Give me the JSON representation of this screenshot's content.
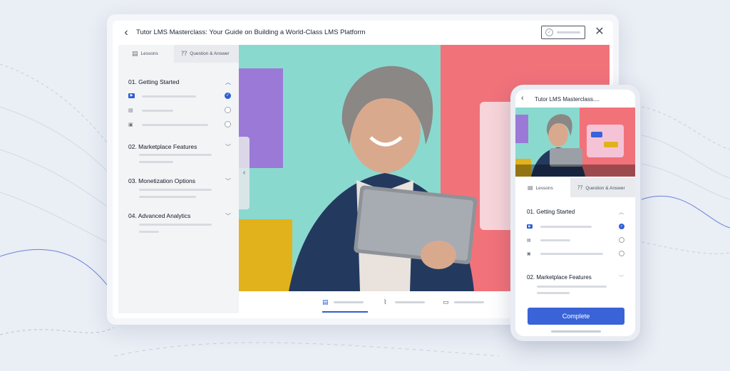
{
  "desktop": {
    "course_title": "Tutor LMS Masterclass: Your Guide on Building a World-Class LMS Platform",
    "tabs": [
      {
        "label": "Lessons",
        "icon": "book-icon",
        "active": true
      },
      {
        "label": "Question & Answer",
        "icon": "qa-icon",
        "active": false
      }
    ],
    "sections": [
      {
        "title": "01. Getting Started",
        "expanded": true,
        "lessons": [
          {
            "icon": "video-icon",
            "completed": true
          },
          {
            "icon": "document-icon",
            "completed": false
          },
          {
            "icon": "quiz-icon",
            "completed": false
          }
        ]
      },
      {
        "title": "02. Marketplace Features",
        "expanded": false
      },
      {
        "title": "03. Monetization Options",
        "expanded": false
      },
      {
        "title": "04. Advanced Analytics",
        "expanded": false
      }
    ],
    "bottom_tabs": [
      {
        "icon": "document-icon",
        "active": true
      },
      {
        "icon": "paperclip-icon",
        "active": false
      },
      {
        "icon": "comment-icon",
        "active": false
      }
    ]
  },
  "mobile": {
    "course_title": "Tutor LMS Masterclass....",
    "tabs": [
      {
        "label": "Lessons",
        "icon": "book-icon",
        "active": true
      },
      {
        "label": "Question & Answer",
        "icon": "qa-icon",
        "active": false
      }
    ],
    "sections": [
      {
        "title": "01. Getting Started",
        "expanded": true
      },
      {
        "title": "02. Marketplace Features",
        "expanded": false
      }
    ],
    "complete_button": "Complete"
  },
  "colors": {
    "accent": "#3a63d8",
    "background": "#eaeef5",
    "video_teal": "#7fd6cc",
    "video_pink": "#f2727a",
    "video_purple": "#9a7ad6",
    "video_yellow": "#e2b21c"
  }
}
